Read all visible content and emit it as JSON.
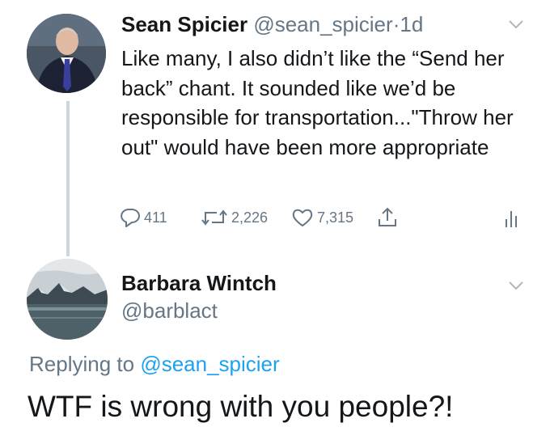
{
  "tweet1": {
    "name": "Sean Spicier",
    "handle": "@sean_spicier",
    "separator": "·",
    "time": "1d",
    "text": "Like many, I also didn’t like the “Send her back” chant. It sounded like we’d be responsible for transportation...\"Throw her out\" would have been more appropriate",
    "actions": {
      "replies": "411",
      "retweets": "2,226",
      "likes": "7,315"
    },
    "icons": {
      "reply": "speech-bubble-icon",
      "retweet": "retweet-arrows-icon",
      "like": "heart-icon",
      "share": "share-upload-icon",
      "analytics": "bar-chart-icon",
      "menu": "chevron-down-icon"
    }
  },
  "tweet2": {
    "name": "Barbara Wintch",
    "handle": "@barblact",
    "replying_prefix": "Replying to",
    "replying_to": "@sean_spicier",
    "text": "WTF is wrong with you people?!"
  },
  "colors": {
    "text": "#14171a",
    "secondary": "#657786",
    "link": "#1da1f2",
    "thread_line": "#ccd6dd"
  }
}
